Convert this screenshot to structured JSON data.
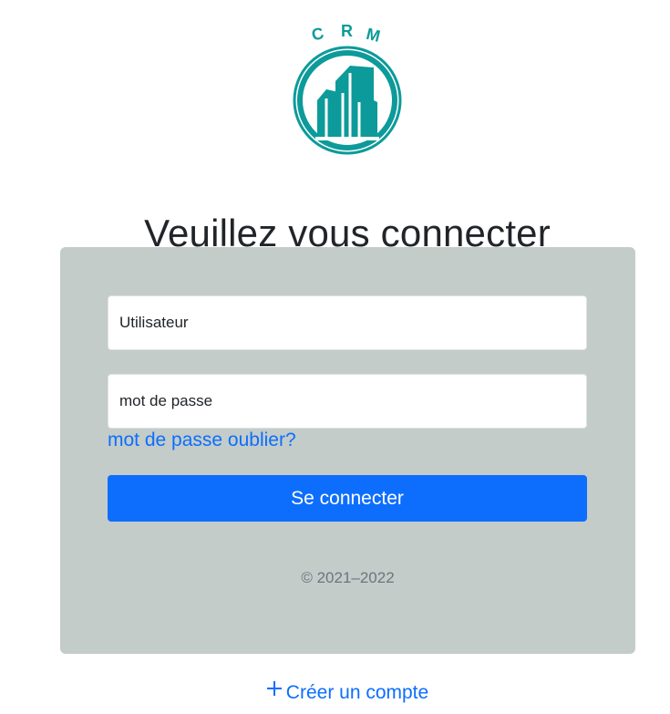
{
  "logo": {
    "text": "CRM",
    "color": "#0d9a9a",
    "icon": "building-logo-icon"
  },
  "title": "Veuillez vous connecter",
  "form": {
    "username_placeholder": "Utilisateur",
    "password_placeholder": "mot de passe",
    "forgot_link": "mot de passe oublier?",
    "submit_label": "Se connecter",
    "copyright": "© 2021–2022"
  },
  "footer": {
    "create_account_label": "Créer un compte",
    "create_account_icon": "plus-icon"
  },
  "colors": {
    "primary": "#0d6efd",
    "card_background": "#c3ccc9",
    "logo_teal": "#0d9a9a"
  }
}
